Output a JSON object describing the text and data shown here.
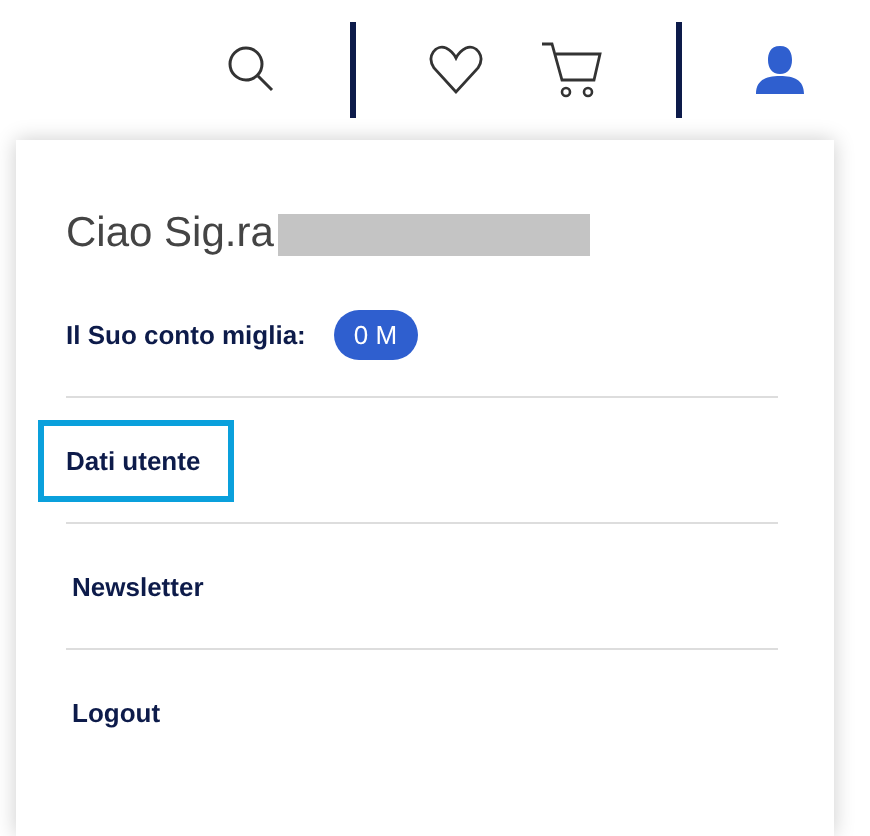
{
  "header": {
    "icons": [
      {
        "kind": "search"
      },
      {
        "kind": "divider"
      },
      {
        "kind": "heart"
      },
      {
        "kind": "cart"
      },
      {
        "kind": "divider"
      },
      {
        "kind": "user"
      }
    ]
  },
  "menu": {
    "greeting": "Ciao Sig.ra",
    "name_redacted": true,
    "miles": {
      "label": "Il Suo conto miglia:",
      "badge": "0 M"
    },
    "items": [
      {
        "label": "Dati utente",
        "focused": true
      },
      {
        "label": "Newsletter",
        "focused": false
      },
      {
        "label": "Logout",
        "focused": false
      }
    ]
  }
}
